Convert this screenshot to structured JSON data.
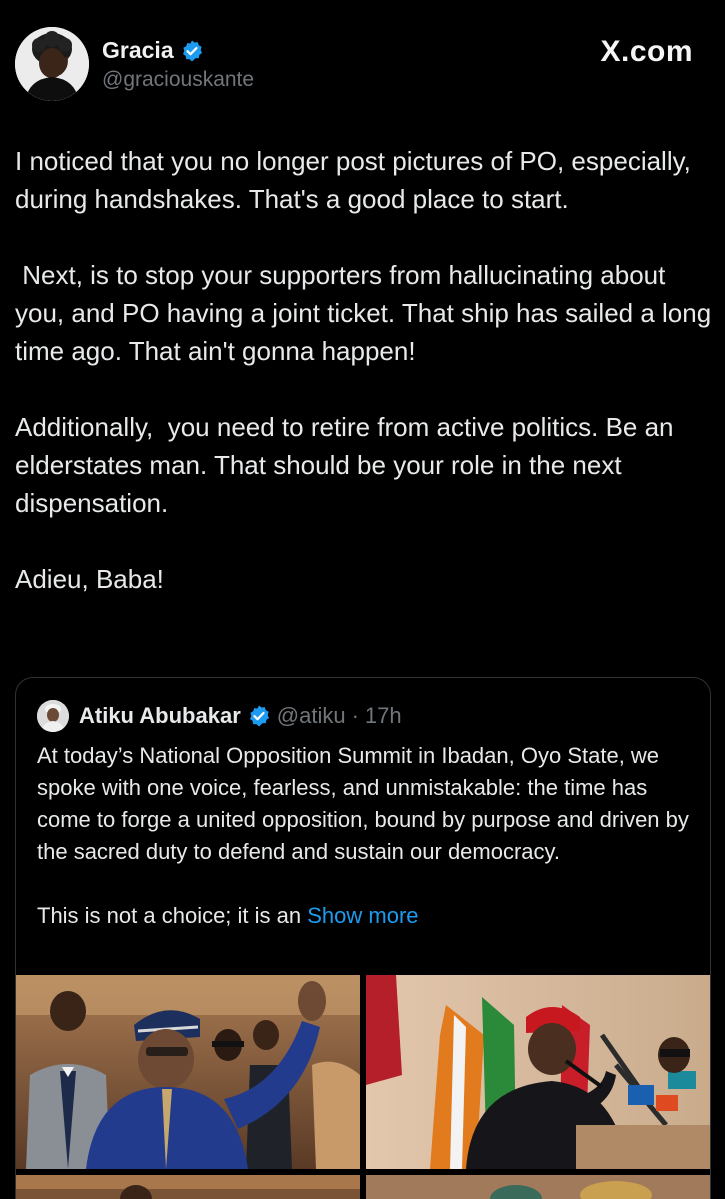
{
  "author": {
    "display_name": "Gracia",
    "handle": "@graciouskante",
    "verified": true,
    "avatar_icon": "profile-photo"
  },
  "brand": {
    "label": "X.com"
  },
  "tweet": {
    "paragraphs": [
      "I noticed that you no longer post pictures of PO, especially, during handshakes. That's a good place to start.",
      " Next, is to stop your supporters from hallucinating about you, and PO having a joint ticket. That ship has sailed a long time ago. That ain't gonna happen!",
      "Additionally,  you need to retire from active politics. Be an elderstates man. That should be your role in the next dispensation.",
      "Adieu, Baba!"
    ]
  },
  "quoted": {
    "display_name": "Atiku Abubakar",
    "handle": "@atiku",
    "separator": "·",
    "time": "17h",
    "verified": true,
    "paragraphs": [
      "At today’s National Opposition Summit in Ibadan, Oyo State, we spoke with one voice, fearless, and unmistakable: the time has come to forge a united opposition, bound by purpose and driven by the sacred duty to defend and sustain our democracy.",
      "This is not a choice; it is an "
    ],
    "show_more": "Show more"
  },
  "colors": {
    "background": "#000000",
    "text": "#e7e9ea",
    "secondary": "#71767b",
    "link": "#1d9bf0",
    "verified": "#1d9bf0",
    "border": "#2f3336"
  }
}
